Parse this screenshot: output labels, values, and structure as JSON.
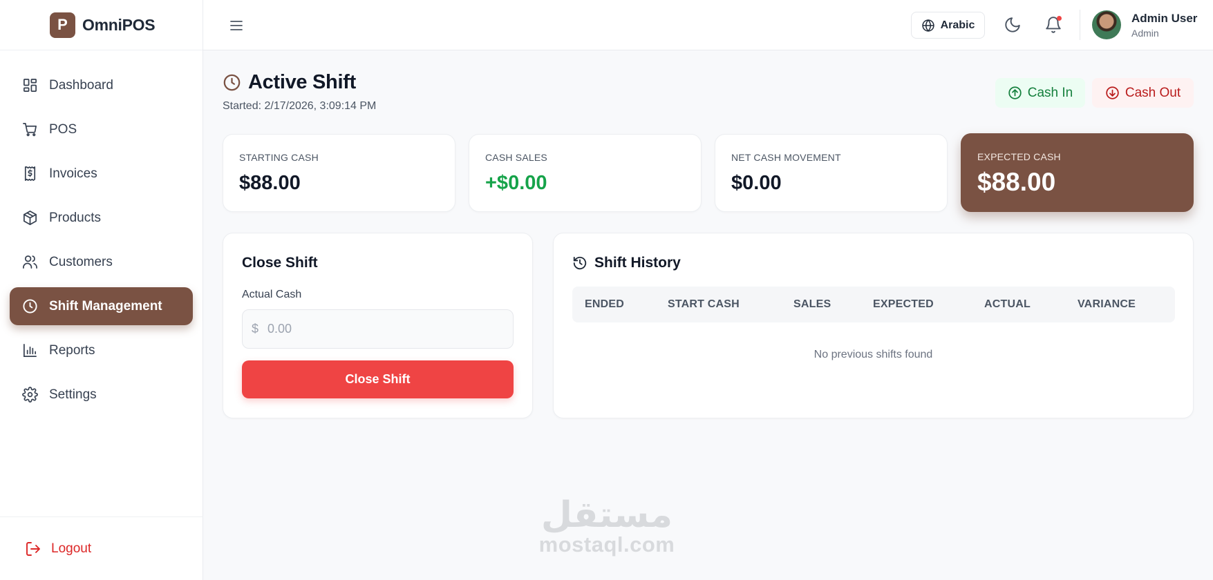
{
  "app": {
    "logo_letter": "P",
    "name": "OmniPOS"
  },
  "sidebar": {
    "items": [
      {
        "label": "Dashboard",
        "icon": "layout-dashboard-icon"
      },
      {
        "label": "POS",
        "icon": "shopping-cart-icon"
      },
      {
        "label": "Invoices",
        "icon": "receipt-icon"
      },
      {
        "label": "Products",
        "icon": "package-icon"
      },
      {
        "label": "Customers",
        "icon": "users-icon"
      },
      {
        "label": "Shift Management",
        "icon": "clock-icon",
        "active": true
      },
      {
        "label": "Reports",
        "icon": "bar-chart-icon"
      },
      {
        "label": "Settings",
        "icon": "gear-icon"
      }
    ],
    "logout_label": "Logout"
  },
  "header": {
    "language_label": "Arabic",
    "user": {
      "name": "Admin User",
      "role": "Admin"
    }
  },
  "page": {
    "title": "Active Shift",
    "started": "Started: 2/17/2026, 3:09:14 PM",
    "cash_in_label": "Cash In",
    "cash_out_label": "Cash Out"
  },
  "stats": [
    {
      "label": "STARTING CASH",
      "value": "$88.00"
    },
    {
      "label": "CASH SALES",
      "value": "+$0.00"
    },
    {
      "label": "NET CASH MOVEMENT",
      "value": "$0.00"
    },
    {
      "label": "EXPECTED CASH",
      "value": "$88.00"
    }
  ],
  "close_shift": {
    "title": "Close Shift",
    "field_label": "Actual Cash",
    "currency_symbol": "$",
    "placeholder": "0.00",
    "button_label": "Close Shift"
  },
  "history": {
    "title": "Shift History",
    "columns": [
      "ENDED",
      "START CASH",
      "SALES",
      "EXPECTED",
      "ACTUAL",
      "VARIANCE"
    ],
    "empty_text": "No previous shifts found"
  },
  "watermark": {
    "arabic": "مستقل",
    "latin": "mostaql.com"
  },
  "colors": {
    "brand": "#7a5243",
    "danger": "#ef4444",
    "success": "#16a34a"
  }
}
